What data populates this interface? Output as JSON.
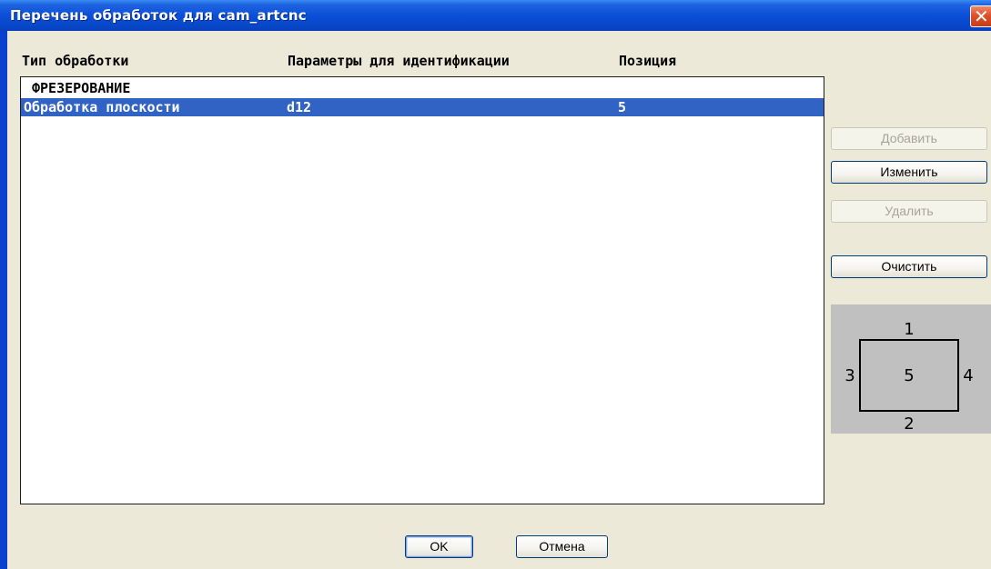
{
  "window": {
    "title": "Перечень обработок для cam_artcnc",
    "close_glyph": "✕"
  },
  "columns": {
    "type": "Тип обработки",
    "params": "Параметры для идентификации",
    "position": "Позиция"
  },
  "list": {
    "group_label": "ФРЕЗЕРОВАНИЕ",
    "items": [
      {
        "type": "Обработка плоскости",
        "params": "d12",
        "position": "5",
        "selected": true
      }
    ]
  },
  "buttons": {
    "add": "Добавить",
    "edit": "Изменить",
    "delete": "Удалить",
    "clear": "Очистить",
    "ok": "OK",
    "cancel": "Отмена"
  },
  "position_diagram": {
    "top": "1",
    "bottom": "2",
    "left": "3",
    "right": "4",
    "center": "5"
  },
  "colors": {
    "selection": "#3163c5",
    "titlebar": "#0a4fd8",
    "dialog_bg": "#ece9d8",
    "diagram_bg": "#c0c0c0"
  }
}
